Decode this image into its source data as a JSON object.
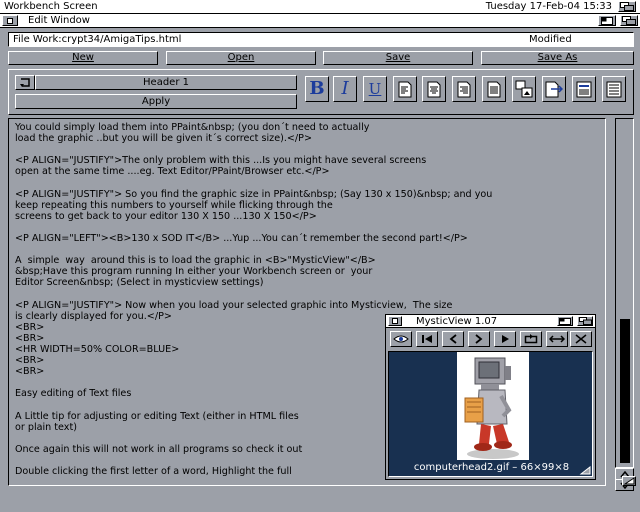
{
  "screen": {
    "title": "Workbench Screen",
    "clock": "Tuesday 17-Feb-04 15:33"
  },
  "edit_window": {
    "title": "Edit Window",
    "file_label": "File  Work:crypt34/AmigaTips.html",
    "status": "Modified"
  },
  "commands": {
    "new": "New",
    "open": "Open",
    "save": "Save",
    "save_as": "Save As"
  },
  "toolbar": {
    "header_select": "Header 1",
    "apply": "Apply",
    "bold": "B",
    "italic": "I",
    "underline": "U",
    "icons": [
      "doc-left-icon",
      "doc-center-icon",
      "doc-right-icon",
      "doc-justify-icon",
      "image-icon",
      "link-icon",
      "list-icon",
      "table-icon"
    ]
  },
  "document": {
    "lines": [
      "You could simply load them into PPaint&nbsp; (you don´t need to actually",
      "load the graphic ..but you will be given it´s correct size).</P>",
      "",
      "<P ALIGN=\"JUSTIFY\">The only problem with this ...Is you might have several screens",
      "open at the same time ....eg. Text Editor/PPaint/Browser etc.</P>",
      "",
      "<P ALIGN=\"JUSTIFY\"> So you find the graphic size in PPaint&nbsp; (Say 130 x 150)&nbsp; and you",
      "keep repeating this numbers to yourself while flicking through the",
      "screens to get back to your editor 130 X 150 ...130 X 150</P>",
      "",
      "<P ALIGN=\"LEFT\"><B>130 x SOD IT</B> ...Yup ...You can´t remember the second part!</P>",
      "",
      "A  simple  way  around this is to load the graphic in <B>\"MysticView\"</B>",
      "&bsp;Have this program running In either your Workbench screen or  your",
      "Editor Screen&nbsp; (Select in mysticview settings)",
      "",
      "<P ALIGN=\"JUSTIFY\"> Now when you load your selected graphic into Mysticview,  The size",
      "is clearly displayed for you.</P>",
      "<BR>",
      "<BR>",
      "<HR WIDTH=50% COLOR=BLUE>",
      "<BR>",
      "<BR>",
      "",
      "Easy editing of Text files",
      "",
      "A Little tip for adjusting or editing Text (either in HTML files",
      "or plain text)",
      "",
      "Once again this will not work in all programs so check it out",
      "",
      "Double clicking the first letter of a word, Highlight the full"
    ]
  },
  "mysticview": {
    "title": "MysticView 1.07",
    "caption": "computerhead2.gif – 66×99×8"
  },
  "colors": {
    "workbench_grey": "#9ca0a8",
    "accent_blue": "#1c3c9c",
    "viewer_bg": "#183050"
  }
}
